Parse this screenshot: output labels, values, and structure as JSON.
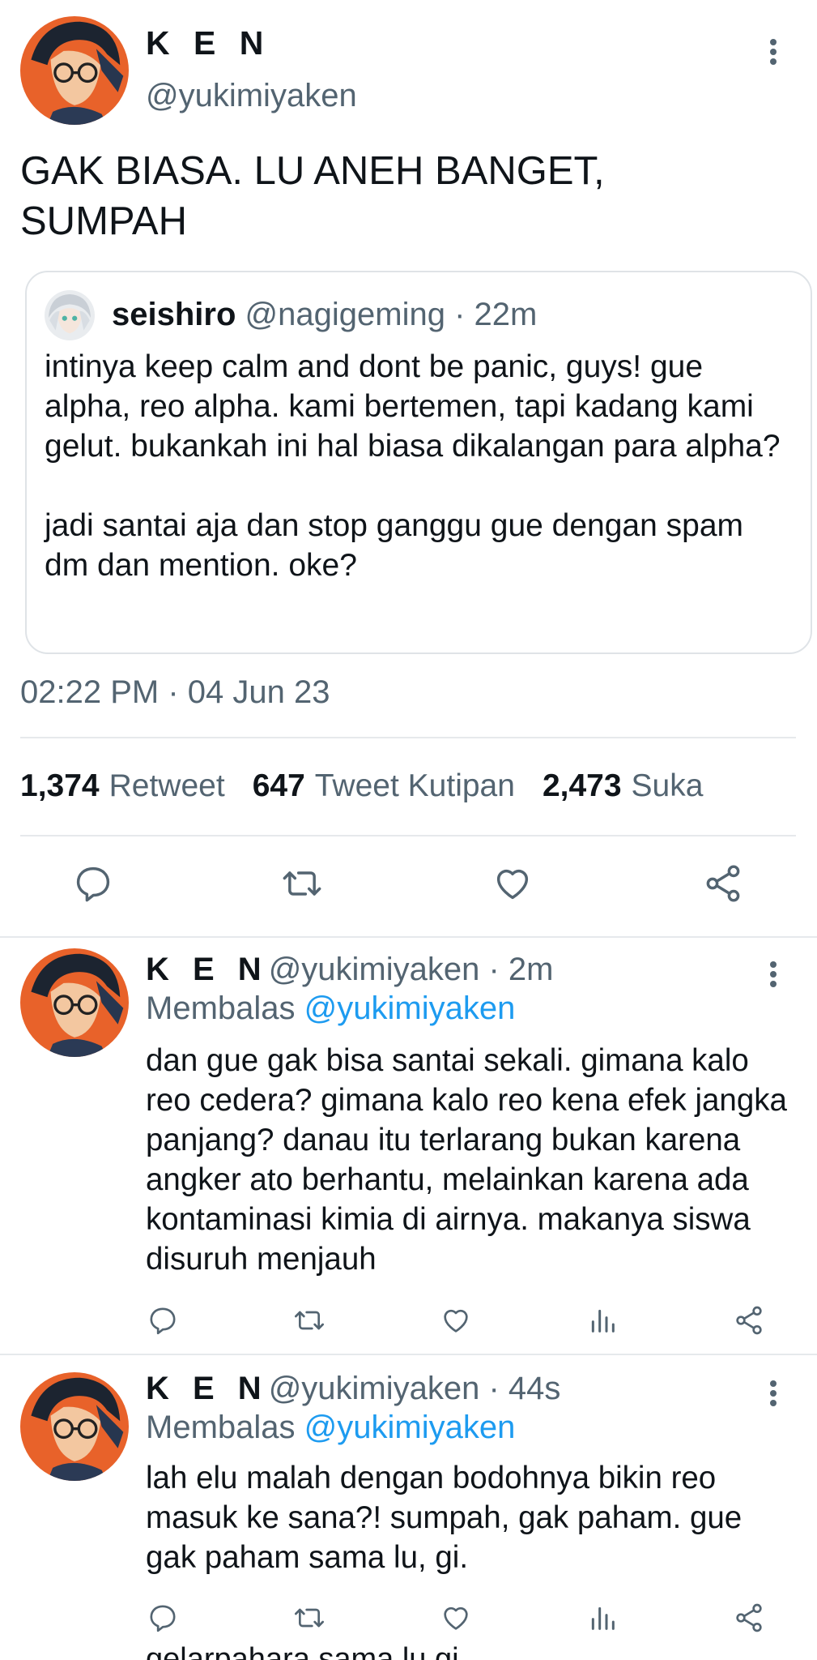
{
  "main_tweet": {
    "author_name": "K E N",
    "author_handle": "@yukimiyaken",
    "text": "GAK BIASA. LU ANEH BANGET, SUMPAH",
    "quoted": {
      "author_name": "seishiro",
      "author_handle": "@nagigeming",
      "time": "· 22m",
      "text": "intinya keep calm and dont be panic, guys! gue alpha, reo alpha. kami bertemen, tapi kadang kami gelut. bukankah ini hal biasa dikalangan para alpha?\n\njadi santai aja dan stop ganggu gue dengan spam dm dan mention. oke?"
    },
    "timestamp": "02:22 PM · 04 Jun 23",
    "stats": [
      {
        "count": "1,374",
        "label": "Retweet"
      },
      {
        "count": "647",
        "label": "Tweet Kutipan"
      },
      {
        "count": "2,473",
        "label": "Suka"
      }
    ],
    "actions": [
      "reply-icon",
      "retweet-icon",
      "like-icon",
      "share-icon"
    ]
  },
  "replies": [
    {
      "author_name": "K E N",
      "author_handle": "@yukimiyaken",
      "time": "· 2m",
      "replying_label": "Membalas",
      "replying_to": "@yukimiyaken",
      "text": "dan gue gak bisa santai sekali. gimana kalo reo cedera? gimana kalo reo kena efek jangka panjang? danau itu terlarang bukan karena angker ato berhantu, melainkan karena ada kontaminasi kimia di airnya. makanya siswa disuruh menjauh"
    },
    {
      "author_name": "K E N",
      "author_handle": "@yukimiyaken",
      "time": "· 44s",
      "replying_label": "Membalas",
      "replying_to": "@yukimiyaken",
      "text": "lah elu malah dengan bodohnya bikin reo masuk ke sana?! sumpah, gak paham. gue gak paham sama lu, gi."
    }
  ],
  "next_preview": "gelarpahara sama lu gi",
  "colors": {
    "text": "#0f1419",
    "muted": "#536471",
    "link": "#1d9bf0",
    "divider": "#e6e9ec"
  }
}
